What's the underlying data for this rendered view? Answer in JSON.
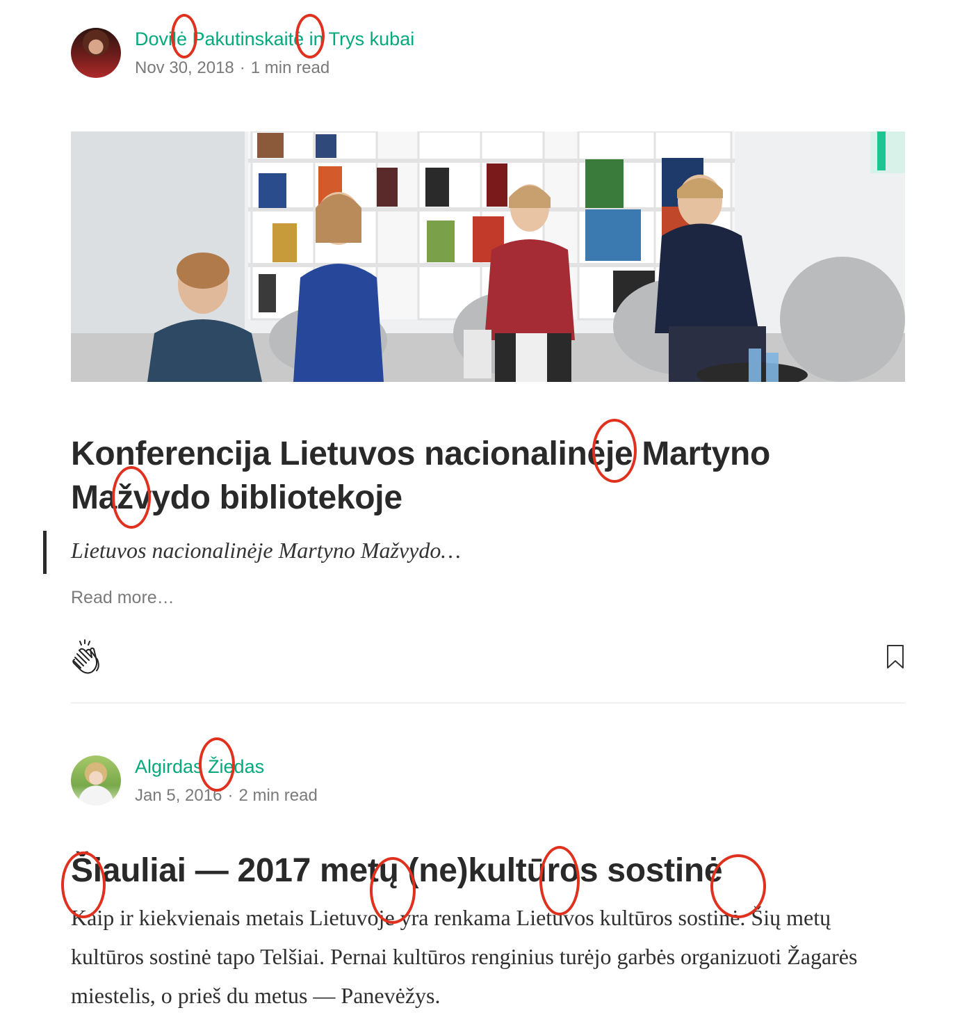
{
  "posts": [
    {
      "author": "Dovilė Pakutinskaitė",
      "in_word": "in",
      "publication": "Trys kubai",
      "date": "Nov 30, 2018",
      "separator": "·",
      "read_time": "1 min read",
      "title": "Konferencija Lietuvos nacionalinėje Martyno Mažvydo bibliotekoje",
      "subtitle": "Lietuvos nacionalinėje Martyno Mažvydo…",
      "read_more": "Read more…",
      "clap_icon": "clap-icon",
      "bookmark_icon": "bookmark-icon"
    },
    {
      "author": "Algirdas Žiedas",
      "date": "Jan 5, 2016",
      "separator": "·",
      "read_time": "2 min read",
      "title": "Šiauliai — 2017 metų (ne)kultūros sostinė",
      "excerpt": "Kaip ir kiekvienais metais Lietuvoje yra renkama Lietuvos kultūros sostinė. Šių metų kultūros sostinė tapo Telšiai. Pernai kultūros renginius turėjo garbės organizuoti Žagarės miestelis, o prieš du metus — Panevėžys."
    }
  ],
  "colors": {
    "accent_green": "#03a87c",
    "annotation_red": "#e0301e",
    "meta_gray": "#7a7a7a"
  }
}
